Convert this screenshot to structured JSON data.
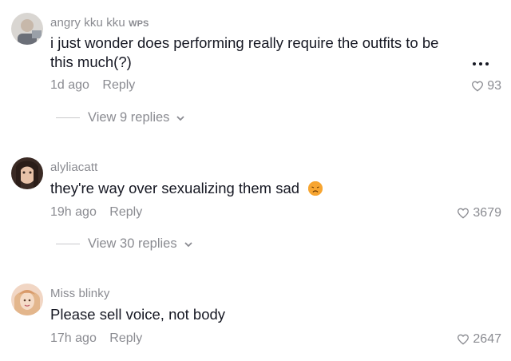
{
  "comments": [
    {
      "username": "angry kku kku",
      "tag": "WPS",
      "text": "i just wonder does performing really require the outfits to be this much(?)",
      "time": "1d ago",
      "reply_label": "Reply",
      "likes": "93",
      "view_replies": "View 9 replies"
    },
    {
      "username": "alyliacatt",
      "text": "they're way over sexualizing them sad",
      "emoji": "disappointed-face",
      "time": "19h ago",
      "reply_label": "Reply",
      "likes": "3679",
      "view_replies": "View 30 replies"
    },
    {
      "username": "Miss blinky",
      "text": "Please sell voice, not body",
      "time": "17h ago",
      "reply_label": "Reply",
      "likes": "2647"
    }
  ],
  "colors": {
    "text_primary": "#161823",
    "text_secondary": "#8a8b91",
    "background": "#ffffff"
  }
}
